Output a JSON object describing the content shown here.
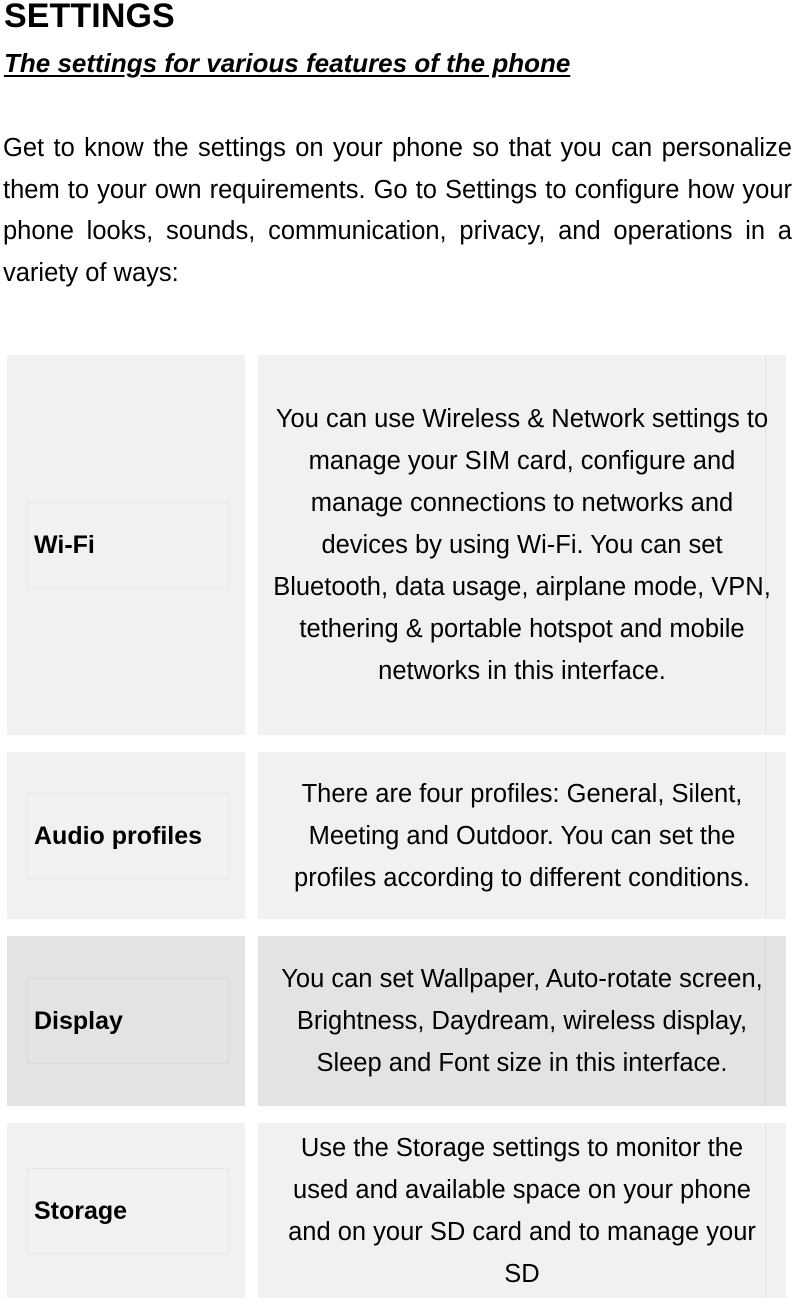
{
  "document": {
    "title": "SETTINGS",
    "subtitle": "The settings for various features of the phone",
    "intro_paragraph": "Get to know the settings on your phone so that you can personalize them to your own requirements. Go to Settings to configure how your phone looks, sounds, communication, privacy, and operations in a variety of ways:"
  },
  "settings_table": {
    "rows": [
      {
        "label": "Wi-Fi",
        "description": "You can use Wireless & Network settings to manage your SIM card, configure and manage connections to networks and devices by using Wi-Fi. You can set Bluetooth, data usage, airplane mode, VPN, tethering & portable hotspot and mobile networks in this interface.",
        "shade": "#f1f1f1"
      },
      {
        "label": "Audio profiles",
        "description": "There are four profiles: General, Silent, Meeting and Outdoor. You can set the profiles according to different conditions.",
        "shade": "#f1f1f1"
      },
      {
        "label": "Display",
        "description": "You can set Wallpaper, Auto-rotate screen, Brightness, Daydream, wireless display, Sleep and Font size in this interface.",
        "shade": "#e3e3e3"
      },
      {
        "label": "Storage",
        "description": "Use the Storage settings to monitor the used and available space on your phone and on your SD card and to manage your SD",
        "shade": "#f1f1f1"
      }
    ]
  }
}
